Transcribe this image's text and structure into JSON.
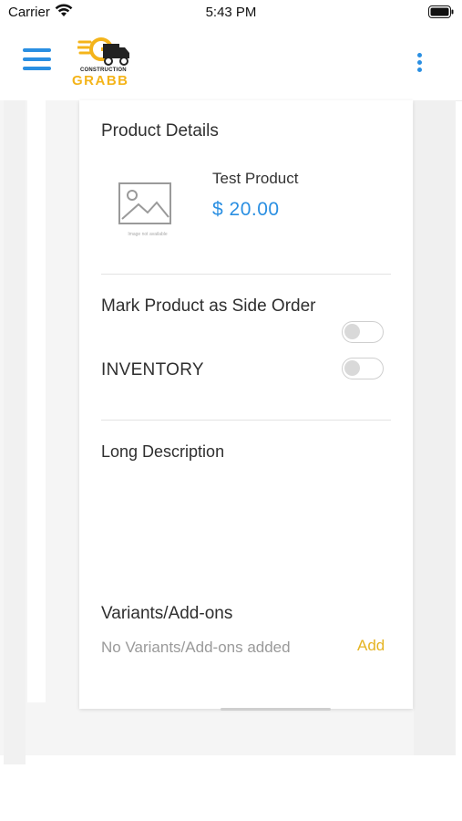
{
  "status_bar": {
    "carrier": "Carrier",
    "time": "5:43 PM"
  },
  "header": {
    "menu_icon": "hamburger-menu-icon",
    "logo": {
      "sub": "CONSTRUCTION",
      "main": "GRABB"
    },
    "more_icon": "more-vertical-icon",
    "accent_color": "#2a8fe2",
    "brand_color": "#f4b41a"
  },
  "product": {
    "section_title": "Product Details",
    "image_caption": "Image not available",
    "name": "Test Product",
    "price": "$ 20.00"
  },
  "options": {
    "side_order_label": "Mark Product as Side Order",
    "side_order_on": false,
    "inventory_label": "INVENTORY",
    "inventory_on": false
  },
  "long_description": {
    "title": "Long Description",
    "value": ""
  },
  "variants": {
    "title": "Variants/Add-ons",
    "empty_text": "No Variants/Add-ons added",
    "add_label": "Add"
  }
}
